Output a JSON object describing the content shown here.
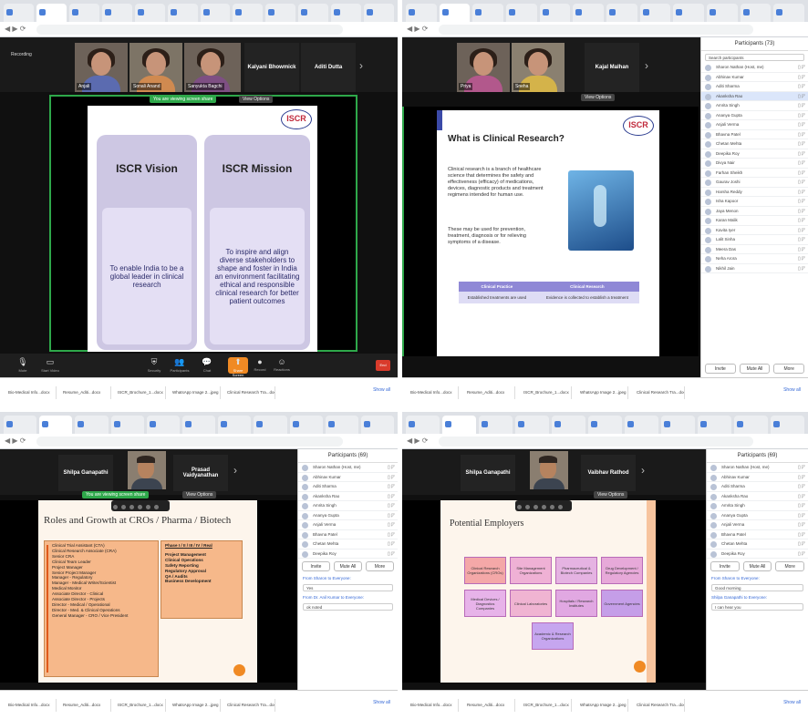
{
  "q1": {
    "participants_tiles": [
      {
        "name": "Anjali"
      },
      {
        "name": "Sonali Anand"
      },
      {
        "name": "Sanyukta Bagchi"
      }
    ],
    "named_tiles": [
      "Kalyani Bhowmick",
      "Aditi Dutta"
    ],
    "recording": "Recording",
    "sharing_label": "You are viewing screen share",
    "view_options": "View Options",
    "slide": {
      "left_title": "ISCR Vision",
      "left_text": "To enable India to be a global leader in clinical research",
      "right_title": "ISCR Mission",
      "right_text": "To inspire and align diverse stakeholders to shape and foster in India an environment facilitating ethical and responsible clinical research for better patient outcomes",
      "logo": "ISCR"
    },
    "toolbar": [
      "Mute",
      "Start Video",
      "Security",
      "Participants",
      "Chat",
      "Share Screen",
      "Record",
      "Reactions",
      "More"
    ],
    "end": "End",
    "downloads": [
      "Bio-Medical Info...docx",
      "Resume_Aditi...docx",
      "ISCR_Brochure_1...docx",
      "WhatsApp Image 2...jpeg",
      "Clinical Research Tra...docx"
    ],
    "show_all": "Show all"
  },
  "q2": {
    "tiles": [
      {
        "name": "Priya"
      },
      {
        "name": "Sneha"
      }
    ],
    "named_tiles": [
      "Kajal Malhan"
    ],
    "view_options": "View Options",
    "participants_title": "Participants (73)",
    "search": "Search participants",
    "participants": [
      "Sharon Nathan (Host, me)",
      "Abhinav Kumar",
      "Aditi Sharma",
      "Akanksha Rao",
      "Amrita Singh",
      "Ananya Gupta",
      "Anjali Verma",
      "Bhavna Patel",
      "Chetan Mehta",
      "Deepika Roy",
      "Divya Nair",
      "Farhan Sheikh",
      "Gaurav Joshi",
      "Harsha Reddy",
      "Isha Kapoor",
      "Jaya Menon",
      "Karan Malik",
      "Kavita Iyer",
      "Lalit Sinha",
      "Meera Das",
      "Neha Arora",
      "Nikhil Jain"
    ],
    "host_row": 3,
    "buttons": [
      "Invite",
      "Mute All",
      "More"
    ],
    "slide": {
      "title": "What is Clinical Research?",
      "bullet1": "Clinical research is a branch of healthcare science that determines the safety and effectiveness (efficacy) of medications, devices, diagnostic products and treatment regimens intended for human use.",
      "bullet2": "These may be used for prevention, treatment, diagnosis or for relieving symptoms of a disease.",
      "col1": "Clinical Practice",
      "col2": "Clinical Research",
      "row1": "Established treatments are used",
      "row2": "Evidence is collected to establish a treatment",
      "logo": "ISCR"
    },
    "downloads": [
      "Bio-Medical Info...docx",
      "Resume_Aditi...docx",
      "ISCR_Brochure_1...docx",
      "WhatsApp Image 2...jpeg",
      "Clinical Research Tra...docx"
    ],
    "show_all": "Show all"
  },
  "q3": {
    "named_tiles": [
      "Shilpa Ganapathi",
      "Prasad Vaidyanathan"
    ],
    "view_options": "View Options",
    "sharing_label": "You are viewing screen share",
    "slide": {
      "title": "Roles and Growth at CROs / Pharma / Biotech",
      "left_list": [
        "Clinical Trial Assistant (CTA)",
        "Clinical Research Associate (CRA)",
        "Senior CRA",
        "Clinical Team Leader",
        "Project Manager",
        "Senior Project Manager",
        "Manager - Regulatory",
        "Manager - Medical Writer/Scientist",
        "Medical Monitor",
        "Associate Director - Clinical",
        "Associate Director - Projects",
        "Director - Medical / Operational",
        "Director - Med. & Clinical Operations",
        "General Manager - CRO / Vice President"
      ],
      "right_title": "Phase I / II / III / IV / Real",
      "right_list": [
        "Project Management",
        "Clinical Operations",
        "Safety Reporting",
        "Regulatory Approval",
        "QA / Audits",
        "Business Development"
      ]
    },
    "panel_title": "Participants (69)",
    "chat": [
      "From Sharon to Everyone:",
      "Yes",
      "From Dr. Anil Kumar to Everyone:",
      "ok noted"
    ],
    "buttons": [
      "Invite",
      "Mute All",
      "More"
    ],
    "downloads": [
      "Bio-Medical Info...docx",
      "Resume_Aditi...docx",
      "ISCR_Brochure_1...docx",
      "WhatsApp Image 2...jpeg",
      "Clinical Research Tra...docx"
    ],
    "show_all": "Show all"
  },
  "q4": {
    "named_tiles": [
      "Shilpa Ganapathi",
      "Vaibhav Rathod"
    ],
    "view_options": "View Options",
    "slide": {
      "title": "Potential Employers",
      "boxes": [
        "Clinical Research Organizations (CROs)",
        "Site Management Organizations",
        "Pharmaceutical & Biotech Companies",
        "Drug Development / Regulatory Agencies",
        "Medical Devices / Diagnostics Companies",
        "Clinical Laboratories",
        "Hospitals / Research Institutes",
        "Government Agencies",
        "Academic & Research Organizations"
      ]
    },
    "panel_title": "Participants (69)",
    "buttons": [
      "Invite",
      "Mute All",
      "More"
    ],
    "chat": [
      "From Sharon to Everyone:",
      "Good morning",
      "Shilpa Ganapathi to Everyone:",
      "I can hear you"
    ],
    "downloads": [
      "Bio-Medical Info...docx",
      "Resume_Aditi...docx",
      "ISCR_Brochure_1...docx",
      "WhatsApp Image 2...jpeg",
      "Clinical Research Tra...docx"
    ],
    "show_all": "Show all"
  }
}
